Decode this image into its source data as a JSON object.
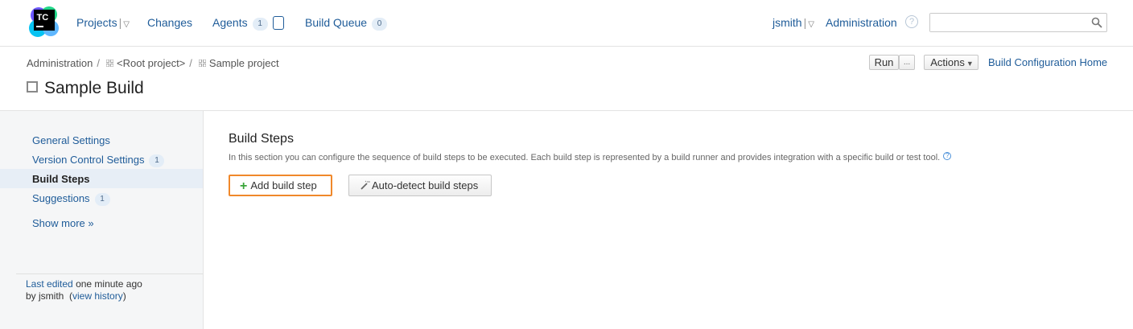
{
  "header": {
    "logo_text": "TC",
    "nav": {
      "projects": "Projects",
      "changes": "Changes",
      "agents": "Agents",
      "agents_count": "1",
      "build_queue": "Build Queue",
      "build_queue_count": "0"
    },
    "user": "jsmith",
    "administration": "Administration",
    "help": "?",
    "search": {
      "value": "",
      "placeholder": ""
    }
  },
  "breadcrumb": {
    "items": [
      "Administration",
      "<Root project>",
      "Sample project"
    ],
    "separator": "/"
  },
  "page": {
    "title": "Sample Build",
    "run_label": "Run",
    "run_more_label": "...",
    "actions_label": "Actions",
    "home_link": "Build Configuration Home"
  },
  "sidebar": {
    "items": [
      {
        "label": "General Settings"
      },
      {
        "label": "Version Control Settings",
        "count": "1"
      },
      {
        "label": "Build Steps",
        "active": true
      },
      {
        "label": "Suggestions",
        "count": "1"
      }
    ],
    "show_more": "Show more »",
    "last_edited_link": "Last edited",
    "last_edited_time": "one minute ago",
    "last_edited_by": "by jsmith",
    "view_history": "view history"
  },
  "main": {
    "title": "Build Steps",
    "description": "In this section you can configure the sequence of build steps to be executed. Each build step is represented by a build runner and provides integration with a specific build or test tool.",
    "add_button": "Add build step",
    "auto_detect_button": "Auto-detect build steps"
  },
  "colors": {
    "link": "#1f5c99",
    "sidebar_bg": "#f5f6f7",
    "active_item_bg": "#e7eef6",
    "highlight_border": "#f0882b",
    "plus_green": "#3aa53a"
  }
}
